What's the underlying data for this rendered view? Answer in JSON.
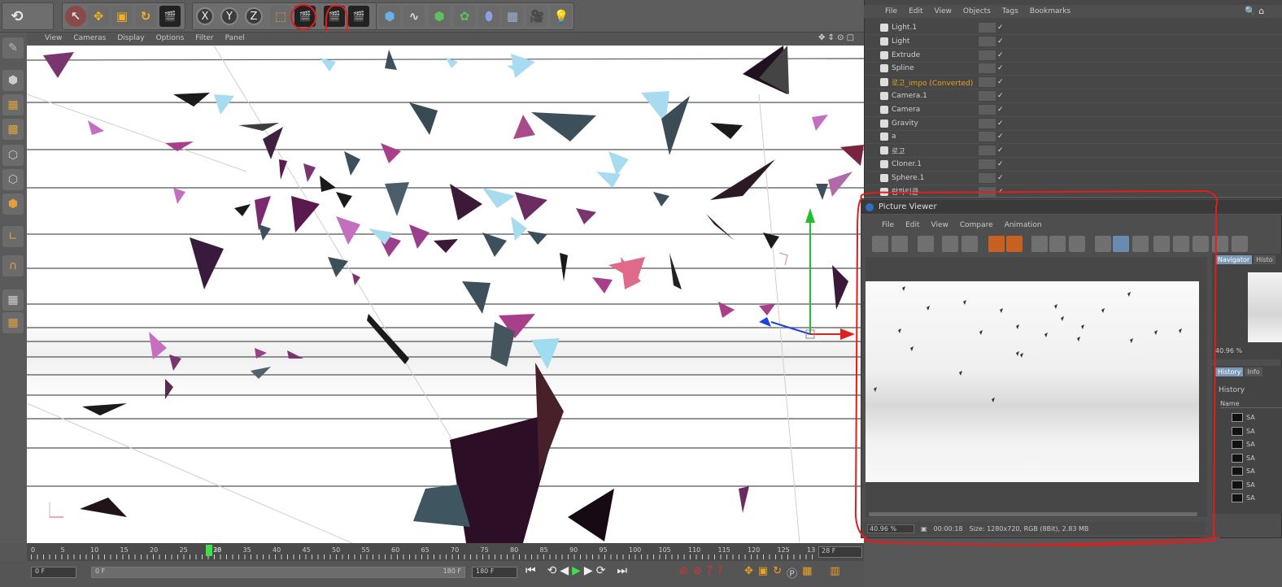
{
  "toolbar": {
    "undo_icon": "undo-icon",
    "axis_labels": [
      "X",
      "Y",
      "Z"
    ]
  },
  "viewport": {
    "menu": [
      "View",
      "Cameras",
      "Display",
      "Options",
      "Filter",
      "Panel"
    ]
  },
  "object_manager": {
    "menu": [
      "File",
      "Edit",
      "View",
      "Objects",
      "Tags",
      "Bookmarks"
    ],
    "rows": [
      {
        "label": "Light.1",
        "color": "#cfcfcf"
      },
      {
        "label": "Light",
        "color": "#cfcfcf"
      },
      {
        "label": "Extrude",
        "color": "#cfcfcf"
      },
      {
        "label": "Spline",
        "color": "#cfcfcf"
      },
      {
        "label": "로고_impo (Converted)",
        "color": "#e8a020"
      },
      {
        "label": "Camera.1",
        "color": "#cfcfcf"
      },
      {
        "label": "Camera",
        "color": "#cfcfcf"
      },
      {
        "label": "Gravity",
        "color": "#cfcfcf"
      },
      {
        "label": "a",
        "color": "#cfcfcf"
      },
      {
        "label": "로고",
        "color": "#cfcfcf"
      },
      {
        "label": "Cloner.1",
        "color": "#cfcfcf"
      },
      {
        "label": "Sphere.1",
        "color": "#cfcfcf"
      },
      {
        "label": "랑파티클",
        "color": "#cfcfcf"
      }
    ]
  },
  "picture_viewer": {
    "title": "Picture Viewer",
    "menu": [
      "File",
      "Edit",
      "View",
      "Compare",
      "Animation"
    ],
    "zoom": "40.96 %",
    "time": "00:00:18",
    "info": "Size: 1280x720, RGB (8Bit), 2.83 MB",
    "nav_tabs": [
      "Navigator",
      "Histo"
    ],
    "nav_zoom": "40.96 %",
    "hist_tabs": [
      "History",
      "Info"
    ],
    "history_header": "History",
    "name_header": "Name",
    "history_items": [
      "SA",
      "SA",
      "SA",
      "SA",
      "SA",
      "SA",
      "SA"
    ]
  },
  "timeline": {
    "ticks": [
      "0",
      "5",
      "10",
      "15",
      "20",
      "25",
      "",
      "30",
      "35",
      "40",
      "45",
      "50",
      "55",
      "60",
      "65",
      "70",
      "75",
      "80",
      "85",
      "90",
      "95",
      "100",
      "105",
      "110",
      "115",
      "120",
      "125",
      "13"
    ],
    "current_frame_label": "28",
    "frame_field": "28 F",
    "start_field": "0 F",
    "range_field_left": "0 F",
    "range_field_right": "180 F",
    "end_field": "180 F"
  }
}
